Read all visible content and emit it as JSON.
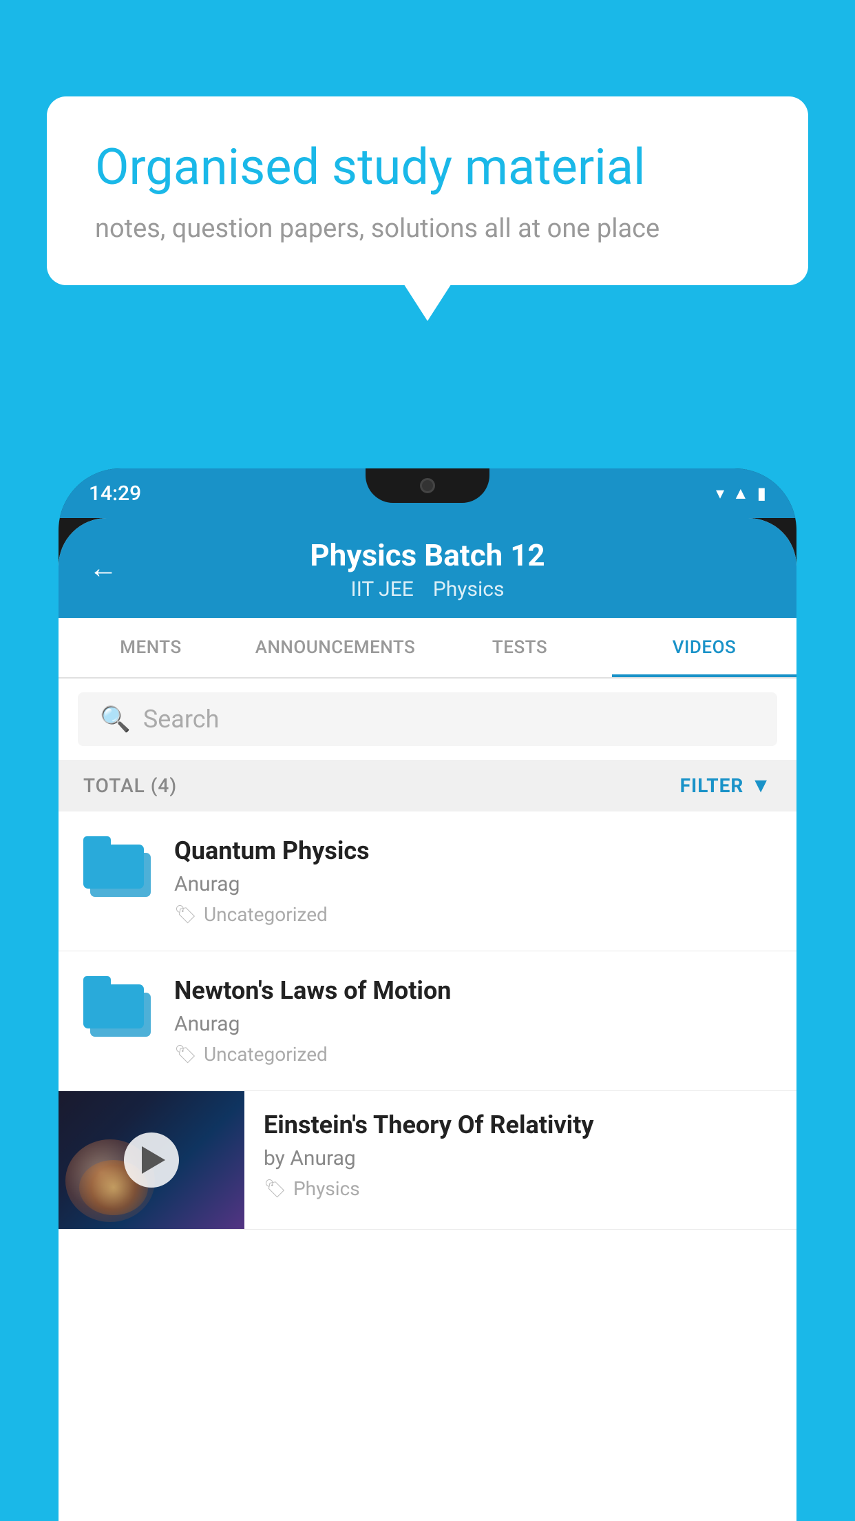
{
  "background_color": "#1AB8E8",
  "bubble": {
    "title": "Organised study material",
    "subtitle": "notes, question papers, solutions all at one place"
  },
  "phone": {
    "status_bar": {
      "time": "14:29",
      "wifi_icon": "wifi-icon",
      "signal_icon": "signal-icon",
      "battery_icon": "battery-icon"
    },
    "header": {
      "back_label": "←",
      "title": "Physics Batch 12",
      "tag1": "IIT JEE",
      "tag2": "Physics"
    },
    "tabs": [
      {
        "label": "MENTS",
        "active": false
      },
      {
        "label": "ANNOUNCEMENTS",
        "active": false
      },
      {
        "label": "TESTS",
        "active": false
      },
      {
        "label": "VIDEOS",
        "active": true
      }
    ],
    "search": {
      "placeholder": "Search"
    },
    "filter_bar": {
      "total_label": "TOTAL (4)",
      "filter_label": "FILTER"
    },
    "videos": [
      {
        "id": "1",
        "title": "Quantum Physics",
        "author": "Anurag",
        "category": "Uncategorized",
        "has_thumbnail": false
      },
      {
        "id": "2",
        "title": "Newton's Laws of Motion",
        "author": "Anurag",
        "category": "Uncategorized",
        "has_thumbnail": false
      },
      {
        "id": "3",
        "title": "Einstein's Theory Of Relativity",
        "author": "by Anurag",
        "category": "Physics",
        "has_thumbnail": true
      }
    ]
  }
}
